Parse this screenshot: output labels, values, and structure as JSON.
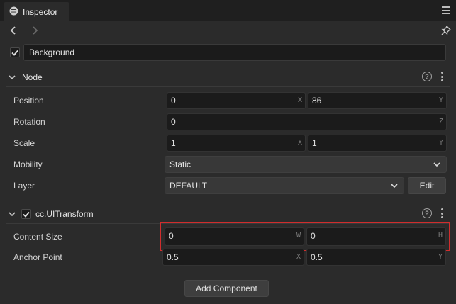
{
  "window": {
    "title": "Inspector"
  },
  "node_name": "Background",
  "sections": {
    "node": {
      "title": "Node"
    },
    "ui_transform": {
      "title": "cc.UITransform"
    }
  },
  "node_props": {
    "position": {
      "label": "Position",
      "x": "0",
      "x_axis": "X",
      "y": "86",
      "y_axis": "Y"
    },
    "rotation": {
      "label": "Rotation",
      "z": "0",
      "z_axis": "Z"
    },
    "scale": {
      "label": "Scale",
      "x": "1",
      "x_axis": "X",
      "y": "1",
      "y_axis": "Y"
    },
    "mobility": {
      "label": "Mobility",
      "value": "Static"
    },
    "layer": {
      "label": "Layer",
      "value": "DEFAULT",
      "edit_label": "Edit"
    }
  },
  "transform_props": {
    "content_size": {
      "label": "Content Size",
      "w": "0",
      "w_axis": "W",
      "h": "0",
      "h_axis": "H"
    },
    "anchor_point": {
      "label": "Anchor Point",
      "x": "0.5",
      "x_axis": "X",
      "y": "0.5",
      "y_axis": "Y"
    }
  },
  "add_component_label": "Add Component",
  "colors": {
    "highlight": "#d12d2d",
    "background": "#2b2b2b",
    "field": "#1b1b1b"
  }
}
